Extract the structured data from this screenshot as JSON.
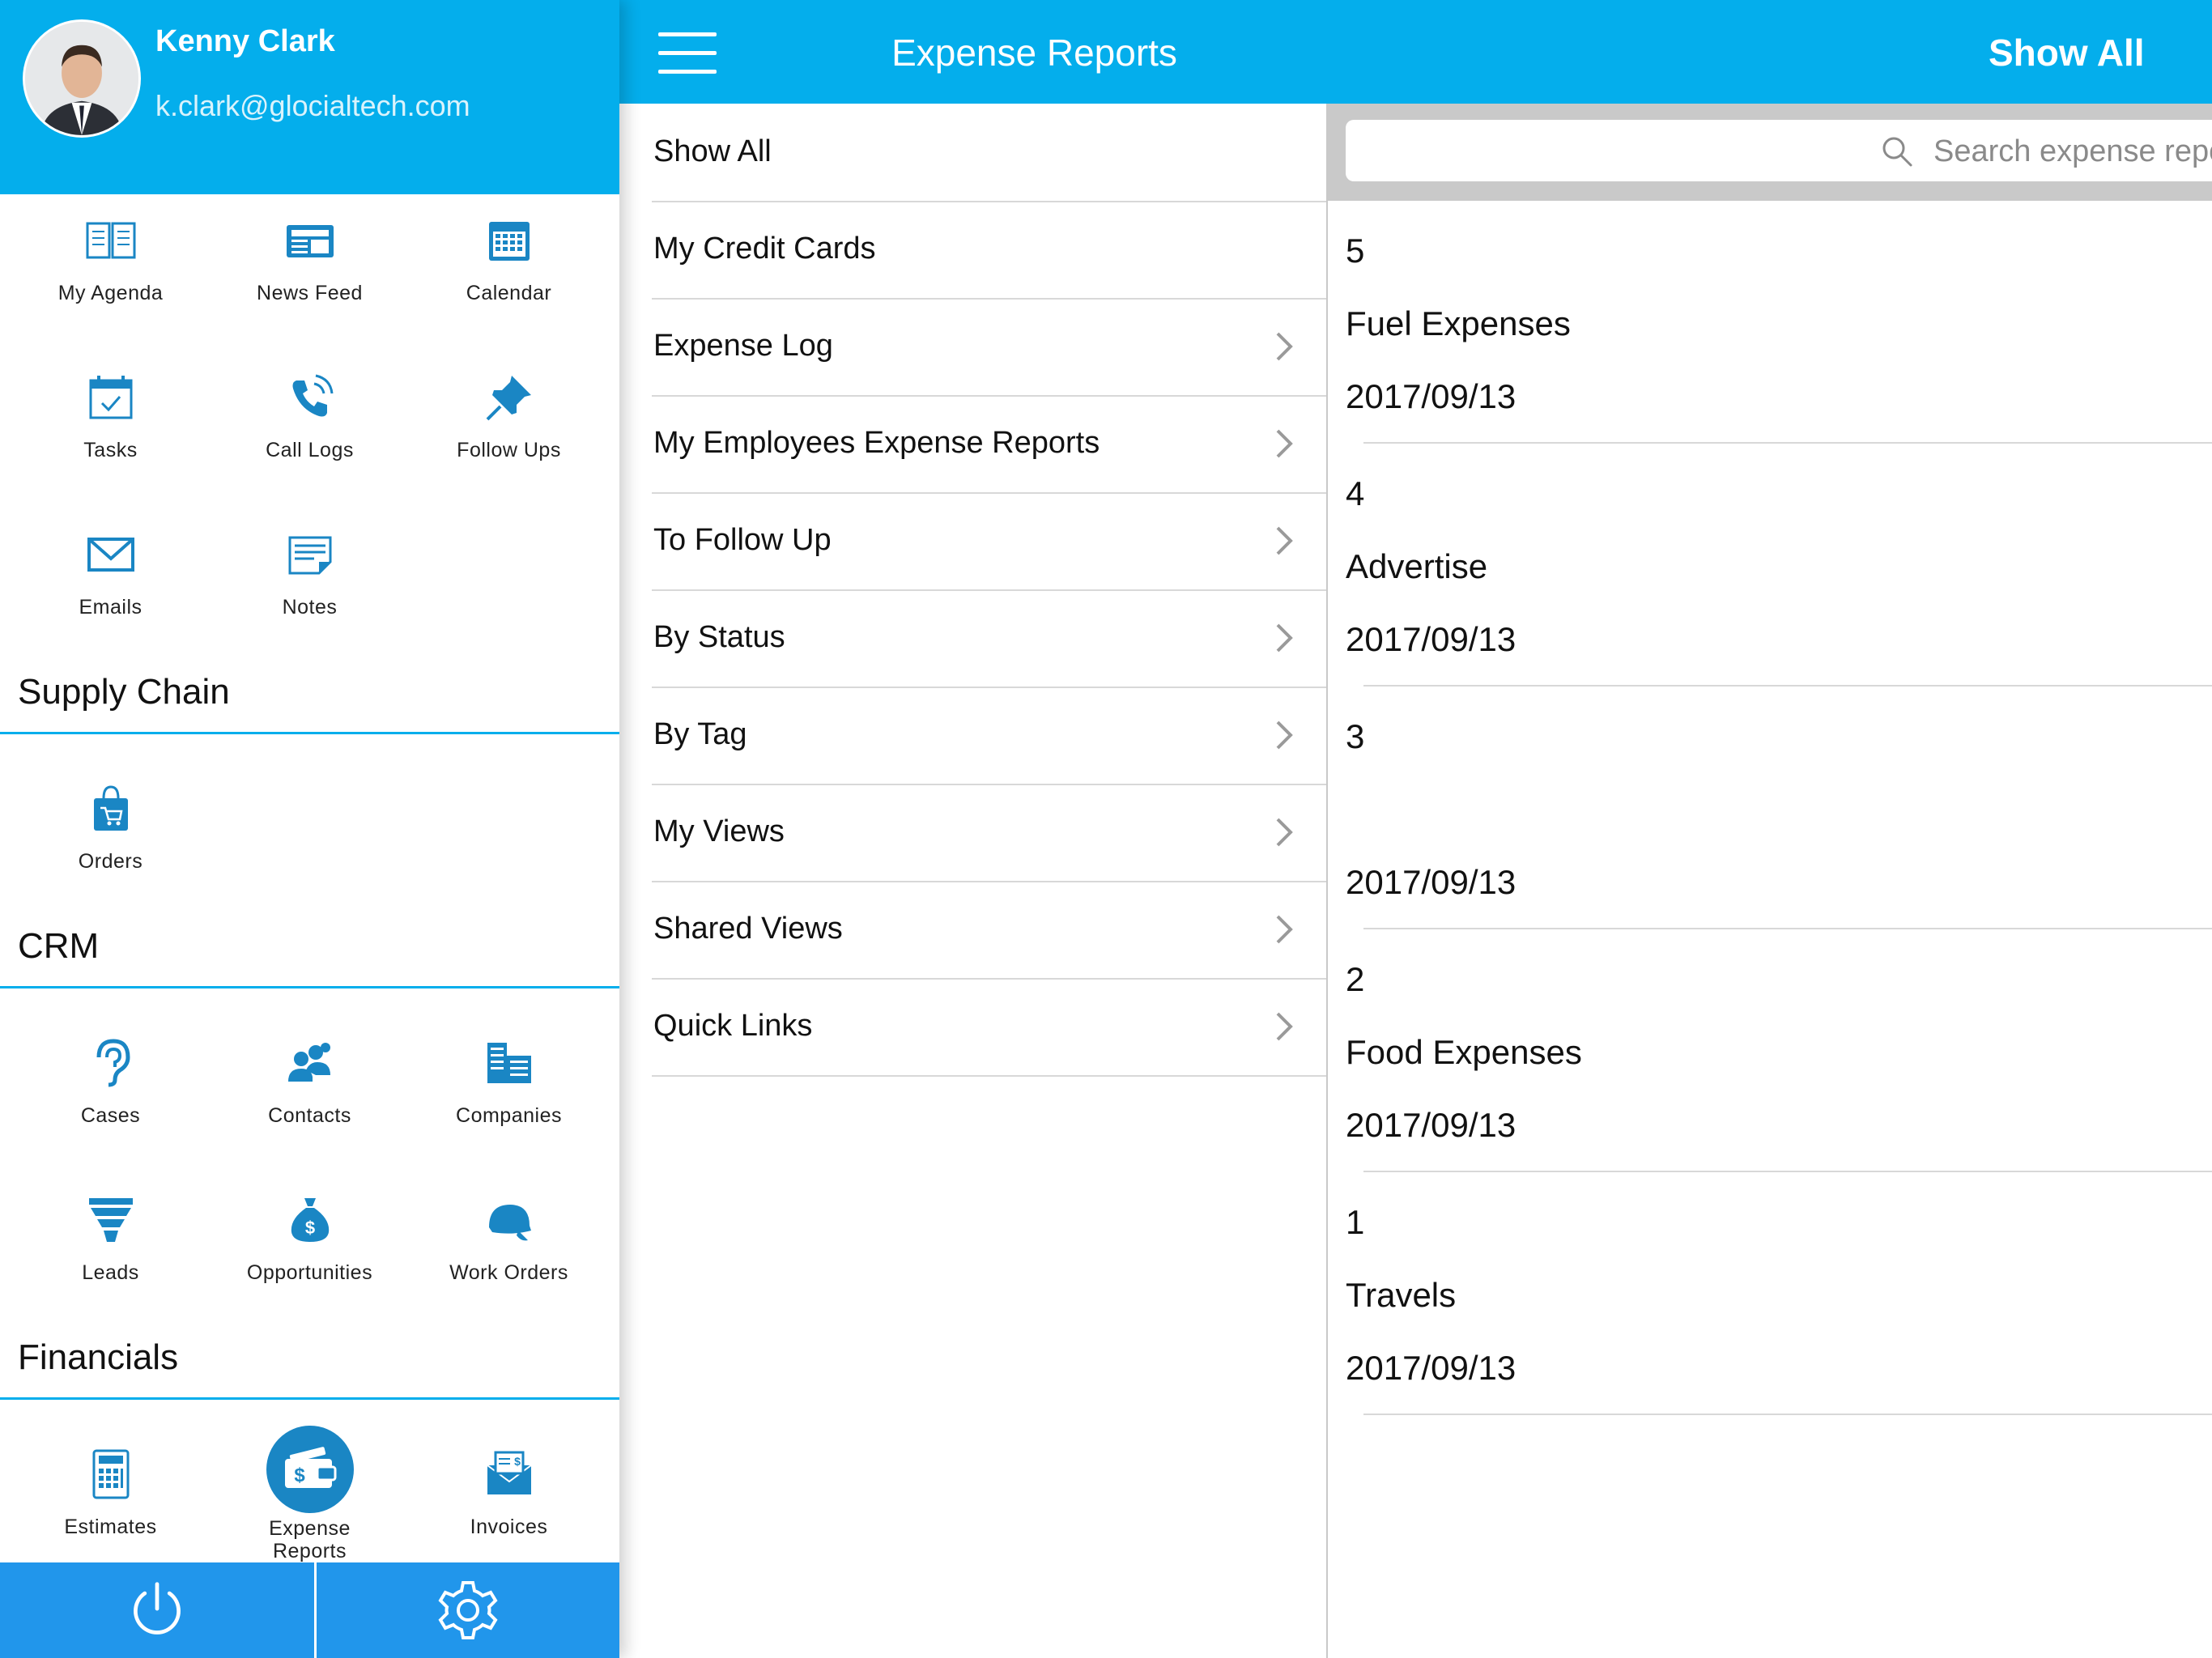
{
  "profile": {
    "name": "Kenny Clark",
    "email": "k.clark@glocialtech.com"
  },
  "tiles": {
    "my_agenda": "My Agenda",
    "news_feed": "News Feed",
    "calendar": "Calendar",
    "tasks": "Tasks",
    "call_logs": "Call Logs",
    "follow_ups": "Follow Ups",
    "emails": "Emails",
    "notes": "Notes",
    "orders": "Orders",
    "cases": "Cases",
    "contacts": "Contacts",
    "companies": "Companies",
    "leads": "Leads",
    "opportunities": "Opportunities",
    "work_orders": "Work Orders",
    "estimates": "Estimates",
    "expense_reports_line1": "Expense",
    "expense_reports_line2": "Reports",
    "invoices": "Invoices"
  },
  "sections": {
    "supply_chain": "Supply Chain",
    "crm": "CRM",
    "financials": "Financials"
  },
  "bottom_bar": {
    "left_icon": "power-icon",
    "right_icon": "gear-icon"
  },
  "middle": {
    "title": "Expense Reports",
    "menu": [
      {
        "label": "Show All"
      },
      {
        "label": "My Credit Cards"
      },
      {
        "label": "Expense Log"
      },
      {
        "label": "My Employees Expense Reports"
      },
      {
        "label": "To Follow Up"
      },
      {
        "label": "By Status"
      },
      {
        "label": "By Tag"
      },
      {
        "label": "My Views"
      },
      {
        "label": "Shared Views"
      },
      {
        "label": "Quick Links"
      }
    ]
  },
  "right": {
    "title": "Show All",
    "search_placeholder": "Search expense reports",
    "reports": [
      {
        "number": "5",
        "title": "Fuel Expenses",
        "date": "2017/09/13"
      },
      {
        "number": "4",
        "title": "Advertise",
        "date": "2017/09/13"
      },
      {
        "number": "3",
        "title": "",
        "date": "2017/09/13"
      },
      {
        "number": "2",
        "title": "Food Expenses",
        "date": "2017/09/13"
      },
      {
        "number": "1",
        "title": "Travels",
        "date": "2017/09/13"
      }
    ]
  },
  "colors": {
    "brand": "#04aeec",
    "icon": "#1a86c4",
    "bottom_bar": "#2196eb"
  }
}
